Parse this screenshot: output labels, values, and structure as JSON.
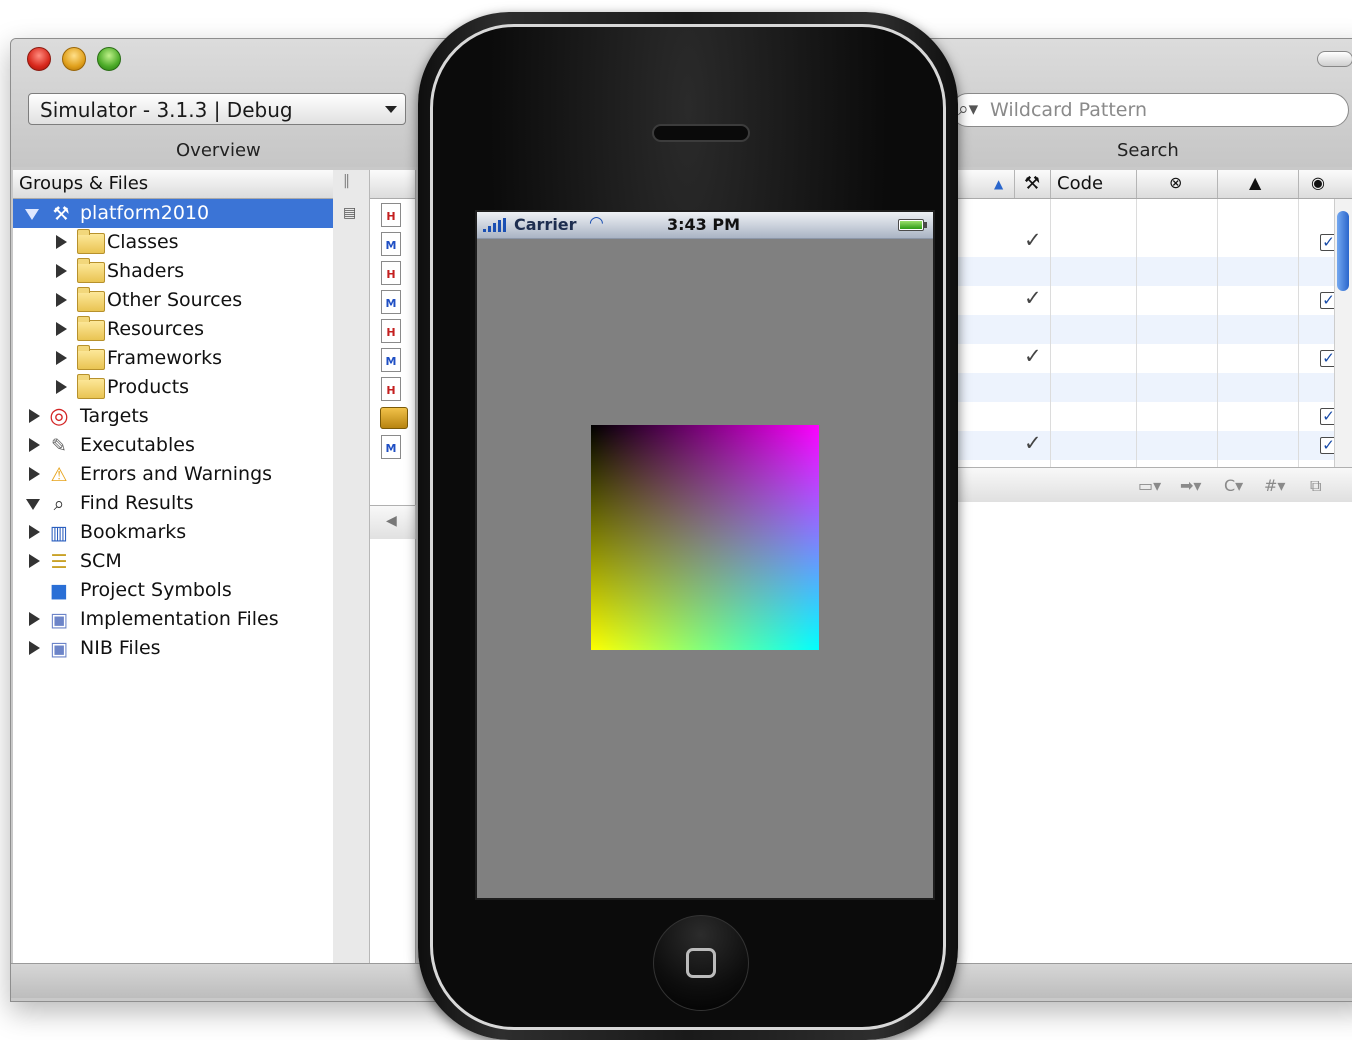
{
  "window": {
    "scheme_selector": "Simulator - 3.1.3 | Debug",
    "overview_label": "Overview",
    "search_placeholder": "Wildcard Pattern",
    "search_label": "Search"
  },
  "sidebar": {
    "header": "Groups & Files",
    "items": [
      {
        "label": "platform2010",
        "icon": "project-icon"
      },
      {
        "label": "Classes",
        "icon": "folder-icon"
      },
      {
        "label": "Shaders",
        "icon": "folder-icon"
      },
      {
        "label": "Other Sources",
        "icon": "folder-icon"
      },
      {
        "label": "Resources",
        "icon": "folder-icon"
      },
      {
        "label": "Frameworks",
        "icon": "folder-icon"
      },
      {
        "label": "Products",
        "icon": "folder-icon"
      },
      {
        "label": "Targets",
        "icon": "target-icon"
      },
      {
        "label": "Executables",
        "icon": "executable-icon"
      },
      {
        "label": "Errors and Warnings",
        "icon": "warning-icon"
      },
      {
        "label": "Find Results",
        "icon": "magnifier-icon"
      },
      {
        "label": "Bookmarks",
        "icon": "bookmark-icon"
      },
      {
        "label": "SCM",
        "icon": "scm-icon"
      },
      {
        "label": "Project Symbols",
        "icon": "symbols-cube-icon"
      },
      {
        "label": "Implementation Files",
        "icon": "smart-group-icon"
      },
      {
        "label": "NIB Files",
        "icon": "smart-group-icon"
      }
    ]
  },
  "file_list": {
    "file_types": [
      "H",
      "M",
      "H",
      "M",
      "H",
      "M",
      "H",
      "toolbox",
      "M"
    ]
  },
  "detail_table": {
    "columns": [
      "Code"
    ],
    "build_checks": [
      false,
      true,
      false,
      true,
      false,
      true,
      false,
      false,
      true
    ],
    "target_checks": [
      false,
      true,
      false,
      true,
      false,
      true,
      false,
      true,
      true
    ]
  },
  "iphone": {
    "carrier": "Carrier",
    "time": "3:43 PM",
    "battery_level": 1.0,
    "colors": {
      "screen_background": "#808080",
      "gradient_top_left": "#000000",
      "gradient_top_right": "#ff00ff",
      "gradient_bottom_left": "#ffff00",
      "gradient_bottom_right": "#00ffff"
    }
  }
}
